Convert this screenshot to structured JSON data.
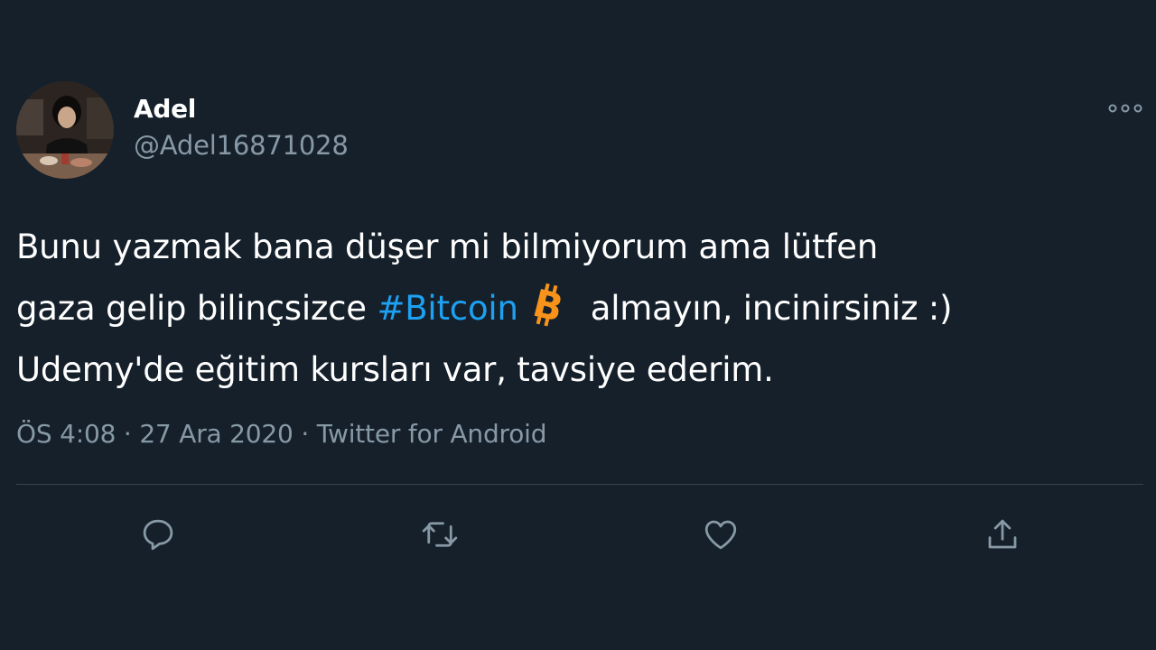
{
  "author": {
    "display_name": "Adel",
    "handle": "@Adel16871028",
    "avatar_icon": "profile-photo"
  },
  "more_icon": "more-horizontal-icon",
  "tweet": {
    "line1": "Bunu yazmak bana düşer mi bilmiyorum ama lütfen",
    "line2_before": "gaza gelip bilinçsizce ",
    "hashtag": "#Bitcoin",
    "emoji": "bitcoin-icon",
    "line2_after": "almayın, incinirsiniz :)",
    "line3": "Udemy'de eğitim kursları var, tavsiye ederim."
  },
  "meta": {
    "time": "ÖS 4:08",
    "separator": " · ",
    "date": "27 Ara 2020",
    "source": "Twitter for Android"
  },
  "actions": [
    {
      "icon": "reply-icon"
    },
    {
      "icon": "retweet-icon"
    },
    {
      "icon": "like-icon"
    },
    {
      "icon": "share-icon"
    }
  ],
  "colors": {
    "background": "#15202b",
    "text": "#ffffff",
    "secondary": "#8899a6",
    "link": "#1da1f2",
    "divider": "#38444d",
    "bitcoin": "#f7931a"
  }
}
